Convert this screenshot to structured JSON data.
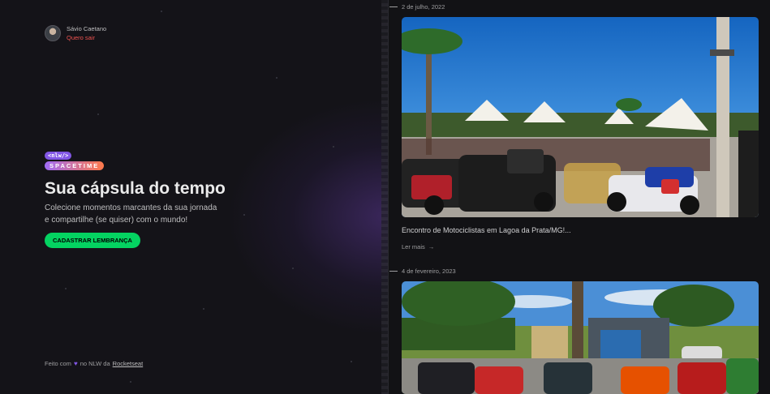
{
  "user": {
    "name": "Sávio Caetano",
    "logout_label": "Quero sair"
  },
  "logo": {
    "tag": "<nlw/>",
    "brand": "SPACETIME"
  },
  "hero": {
    "title": "Sua cápsula do tempo",
    "subtitle": "Colecione momentos marcantes da sua jornada e compartilhe (se quiser) com o mundo!",
    "cta_label": "CADASTRAR LEMBRANÇA"
  },
  "footer": {
    "made_with": "Feito com",
    "heart_icon": "heart-icon",
    "middle": "no NLW da",
    "link": "Rocketseat"
  },
  "memories": [
    {
      "date": "2 de julho, 2022",
      "title": "Encontro de Motociclistas em Lagoa da Prata/MG!...",
      "read_more": "Ler mais"
    },
    {
      "date": "4 de fevereiro, 2023"
    }
  ],
  "colors": {
    "accent_green": "#04d361",
    "purple": "#8257e5",
    "logout_red": "#ef5350",
    "background": "#121215"
  }
}
